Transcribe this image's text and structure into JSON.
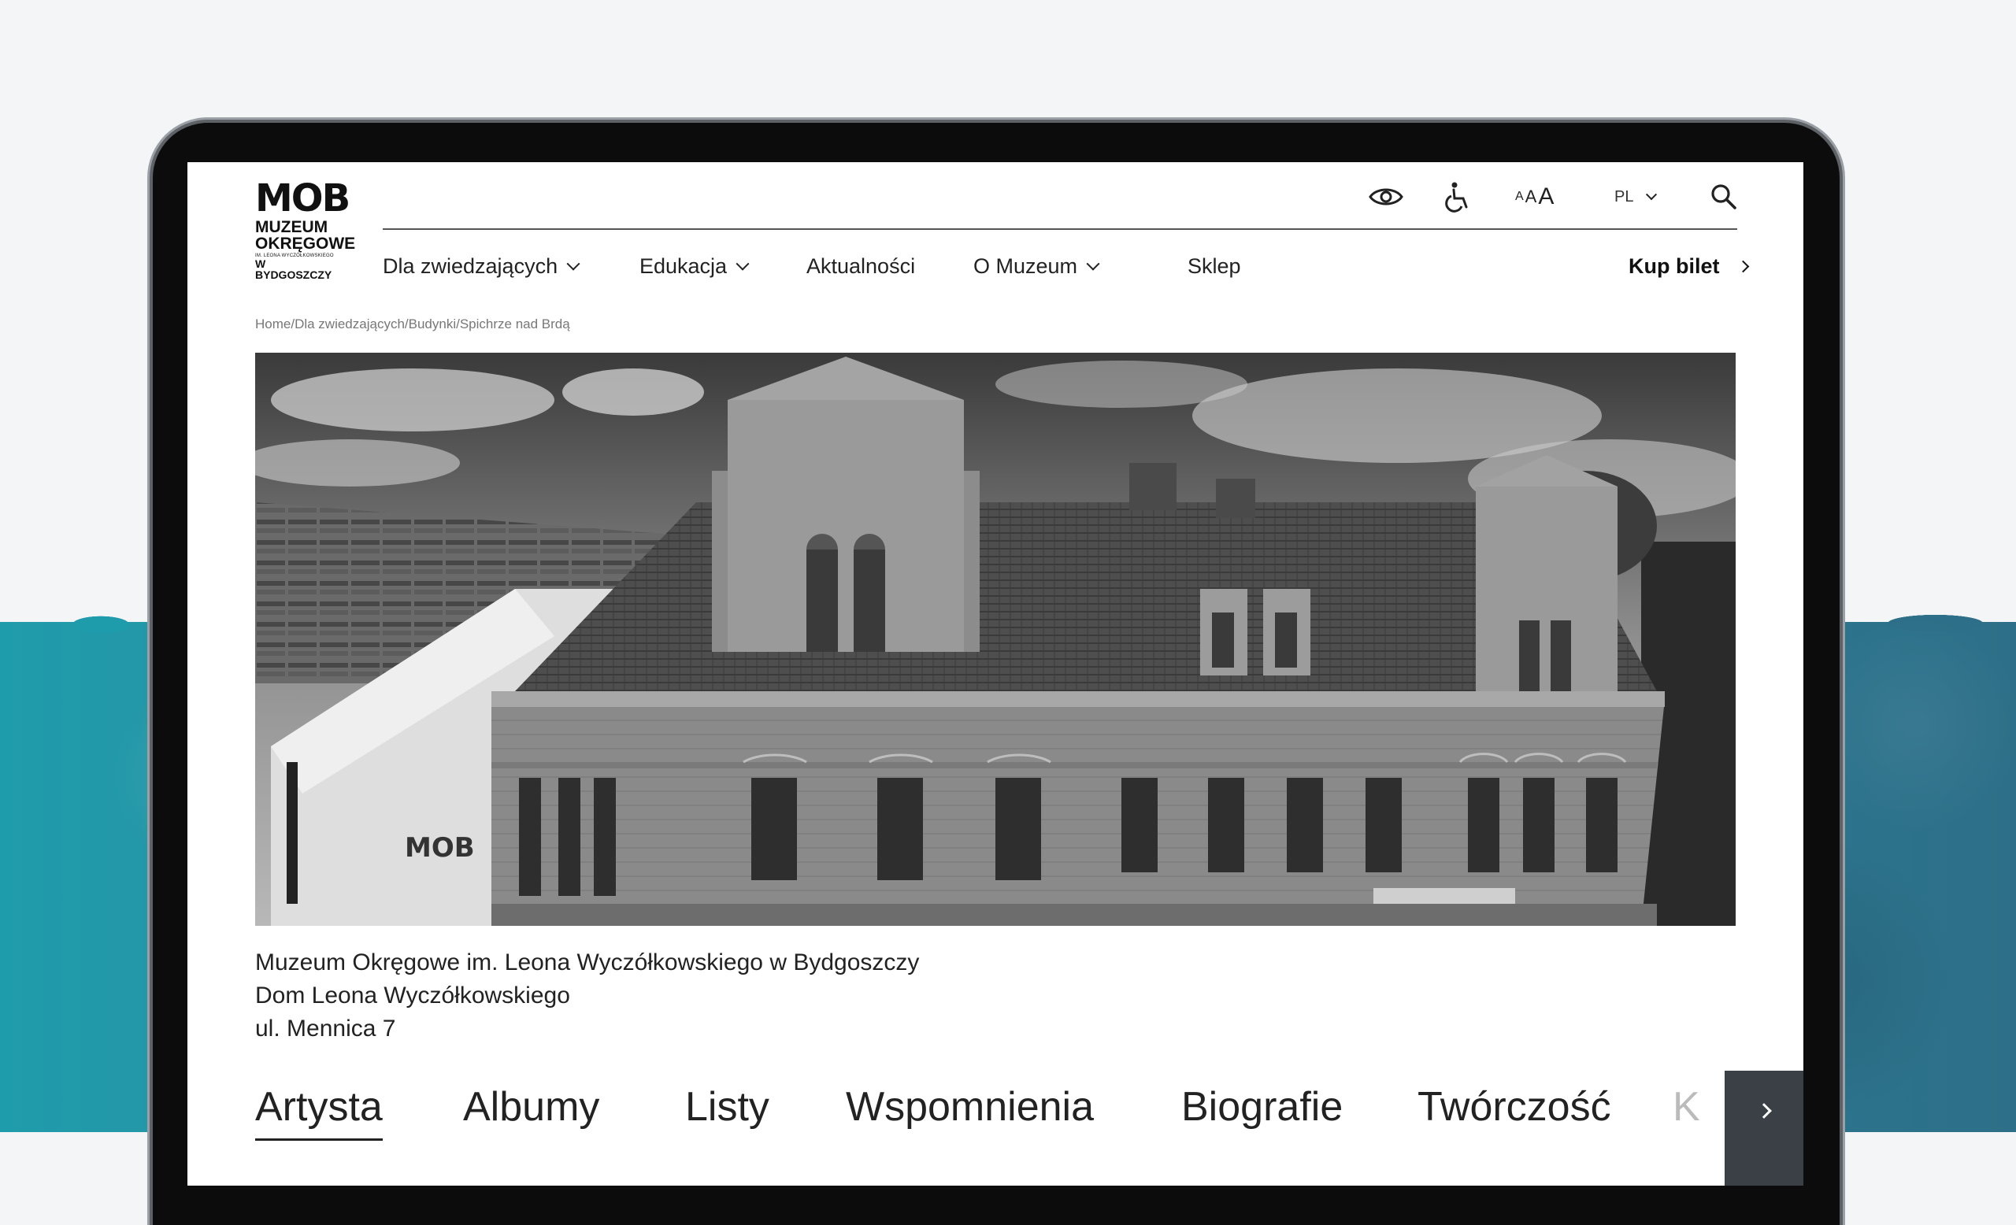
{
  "logo": {
    "mark": "MOB",
    "line1": "MUZEUM",
    "line2": "OKRĘGOWE",
    "line3": "IM. LEONA WYCZÓŁKOWSKIEGO",
    "line4": "W BYDGOSZCZY"
  },
  "utility": {
    "contrast_icon": "eye-icon",
    "accessibility_icon": "wheelchair-icon",
    "text_size_small": "A",
    "text_size_medium": "A",
    "text_size_large": "A",
    "language": "PL",
    "search_icon": "search-icon"
  },
  "nav": {
    "items": [
      {
        "label": "Dla zwiedzających",
        "has_dropdown": true
      },
      {
        "label": "Edukacja",
        "has_dropdown": true
      },
      {
        "label": "Aktualności",
        "has_dropdown": false
      },
      {
        "label": "O Muzeum",
        "has_dropdown": true
      },
      {
        "label": "Sklep",
        "has_dropdown": false
      }
    ],
    "cta": "Kup bilet"
  },
  "breadcrumb": "Home/Dla zwiedzających/Budynki/Spichrze nad Brdą",
  "caption": {
    "line1": "Muzeum Okręgowe im. Leona Wyczółkowskiego w Bydgoszczy",
    "line2": "Dom Leona Wyczółkowskiego",
    "line3": "ul. Mennica 7"
  },
  "tabs": {
    "items": [
      "Artysta",
      "Albumy",
      "Listy",
      "Wspomnienia",
      "Biografie",
      "Twórczość",
      "K"
    ],
    "active": "Artysta"
  },
  "colors": {
    "teal": "#2a8fa1",
    "device_frame": "#0c0c0c",
    "next_button": "#3b4046"
  }
}
